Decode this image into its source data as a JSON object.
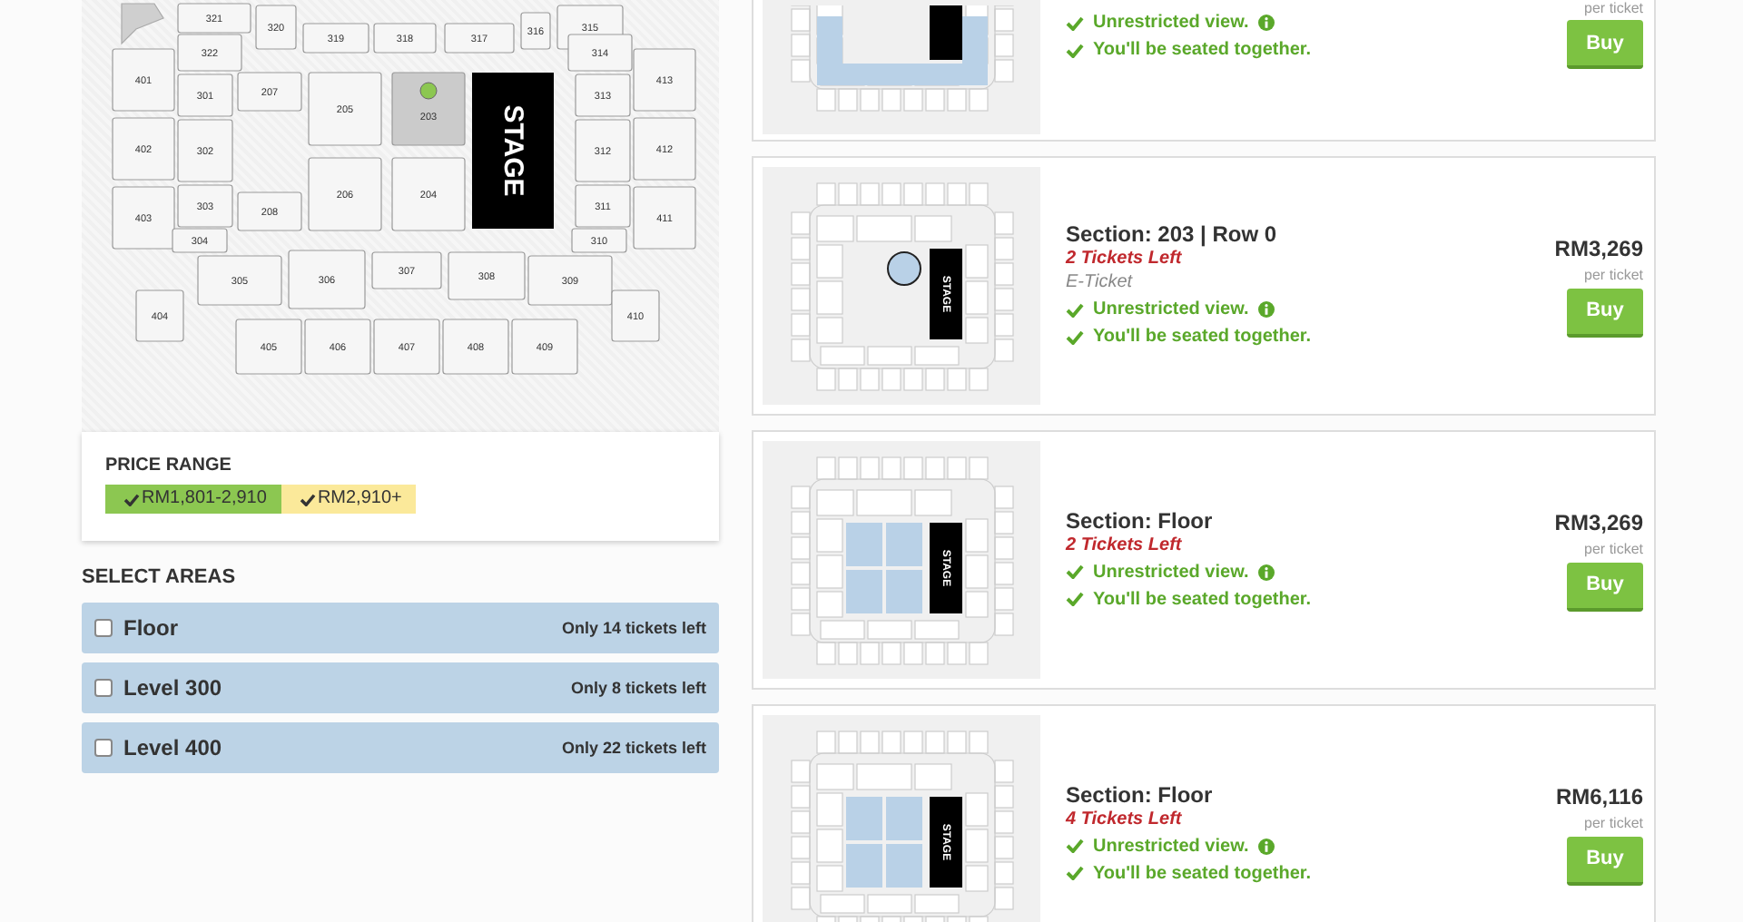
{
  "seat_map": {
    "stage_label": "STAGE",
    "sections": [
      {
        "label": "321",
        "selected": false
      },
      {
        "label": "320",
        "selected": false
      },
      {
        "label": "319",
        "selected": false
      },
      {
        "label": "318",
        "selected": false
      },
      {
        "label": "317",
        "selected": false
      },
      {
        "label": "316",
        "selected": false
      },
      {
        "label": "315",
        "selected": false
      },
      {
        "label": "322",
        "selected": false
      },
      {
        "label": "314",
        "selected": false
      },
      {
        "label": "401",
        "selected": false
      },
      {
        "label": "301",
        "selected": false
      },
      {
        "label": "207",
        "selected": false
      },
      {
        "label": "205",
        "selected": false
      },
      {
        "label": "203",
        "selected": true
      },
      {
        "label": "313",
        "selected": false
      },
      {
        "label": "413",
        "selected": false
      },
      {
        "label": "402",
        "selected": false
      },
      {
        "label": "302",
        "selected": false
      },
      {
        "label": "312",
        "selected": false
      },
      {
        "label": "412",
        "selected": false
      },
      {
        "label": "403",
        "selected": false
      },
      {
        "label": "303",
        "selected": false
      },
      {
        "label": "208",
        "selected": false
      },
      {
        "label": "206",
        "selected": false
      },
      {
        "label": "204",
        "selected": false
      },
      {
        "label": "311",
        "selected": false
      },
      {
        "label": "411",
        "selected": false
      },
      {
        "label": "304",
        "selected": false
      },
      {
        "label": "310",
        "selected": false
      },
      {
        "label": "305",
        "selected": false
      },
      {
        "label": "306",
        "selected": false
      },
      {
        "label": "307",
        "selected": false
      },
      {
        "label": "308",
        "selected": false
      },
      {
        "label": "309",
        "selected": false
      },
      {
        "label": "404",
        "selected": false
      },
      {
        "label": "410",
        "selected": false
      },
      {
        "label": "405",
        "selected": false
      },
      {
        "label": "406",
        "selected": false
      },
      {
        "label": "407",
        "selected": false
      },
      {
        "label": "408",
        "selected": false
      },
      {
        "label": "409",
        "selected": false
      }
    ]
  },
  "price_range": {
    "title": "PRICE RANGE",
    "chips": [
      {
        "label": "RM1,801-2,910",
        "color": "#8cc751",
        "checked": true
      },
      {
        "label": "RM2,910+",
        "color": "#fbe99a",
        "checked": true
      }
    ]
  },
  "select_areas": {
    "title": "SELECT AREAS",
    "areas": [
      {
        "label": "Floor",
        "note": "Only 14 tickets left",
        "checked": false
      },
      {
        "label": "Level 300",
        "note": "Only 8 tickets left",
        "checked": false
      },
      {
        "label": "Level 400",
        "note": "Only 22 tickets left",
        "checked": false
      }
    ]
  },
  "listings": [
    {
      "kind": "ring",
      "features": [
        {
          "text": "Unrestricted view.",
          "info": true
        },
        {
          "text": "You'll be seated together.",
          "info": false
        }
      ],
      "per": "per ticket",
      "buy": "Buy"
    },
    {
      "kind": "seat",
      "map_label": "STAGE",
      "section": "Section: 203 | Row 0",
      "left": "2 Tickets Left",
      "delivery": "E-Ticket",
      "features": [
        {
          "text": "Unrestricted view.",
          "info": true
        },
        {
          "text": "You'll be seated together.",
          "info": false
        }
      ],
      "price": "RM3,269",
      "per": "per ticket",
      "buy": "Buy"
    },
    {
      "kind": "floor",
      "map_label": "STAGE",
      "section": "Section: Floor",
      "left": "2 Tickets Left",
      "features": [
        {
          "text": "Unrestricted view.",
          "info": true
        },
        {
          "text": "You'll be seated together.",
          "info": false
        }
      ],
      "price": "RM3,269",
      "per": "per ticket",
      "buy": "Buy"
    },
    {
      "kind": "floor",
      "map_label": "STAGE",
      "section": "Section: Floor",
      "left": "4 Tickets Left",
      "features": [
        {
          "text": "Unrestricted view.",
          "info": true
        },
        {
          "text": "You'll be seated together.",
          "info": false
        }
      ],
      "price": "RM6,116",
      "per": "per ticket",
      "buy": "Buy"
    }
  ]
}
